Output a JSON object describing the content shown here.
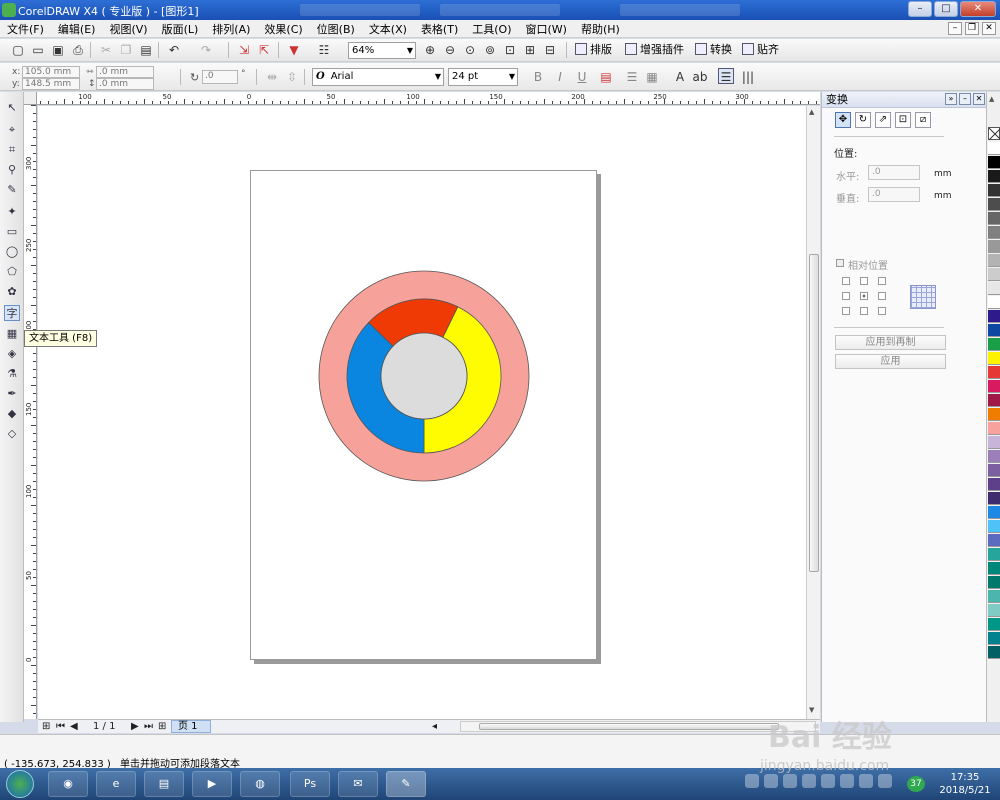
{
  "window": {
    "title": "CorelDRAW X4 ( 专业版 ) - [图形1]",
    "controls": [
      "–",
      "□",
      "✕"
    ]
  },
  "menu": [
    "文件(F)",
    "编辑(E)",
    "视图(V)",
    "版面(L)",
    "排列(A)",
    "效果(C)",
    "位图(B)",
    "文本(X)",
    "表格(T)",
    "工具(O)",
    "窗口(W)",
    "帮助(H)"
  ],
  "toolbar": {
    "zoom": "64%",
    "buttons": [
      "排版",
      "增强插件",
      "转换",
      "贴齐"
    ]
  },
  "property_bar": {
    "x_label": "x:",
    "x_value": "105.0 mm",
    "y_label": "y:",
    "y_value": "148.5 mm",
    "width_value": ".0 mm",
    "height_value": ".0 mm",
    "angle_value": ".0",
    "angle_unit": "°",
    "font_glyph": "O",
    "font_name": "Arial",
    "font_size": "24 pt"
  },
  "tooltip": "文本工具 (F8)",
  "rulers": {
    "horizontal": [
      "100",
      "50",
      "0",
      "50",
      "100",
      "150",
      "200",
      "250",
      "300"
    ],
    "vertical": [
      "300",
      "250",
      "200",
      "150",
      "100",
      "50",
      "0"
    ]
  },
  "page_nav": {
    "counter": "1 / 1",
    "tab": "页 1"
  },
  "docker": {
    "title": "变换",
    "section": "位置:",
    "h_label": "水平:",
    "h_value": ".0",
    "v_label": "垂直:",
    "v_value": ".0",
    "unit": "mm",
    "relative": "相对位置",
    "apply_duplicate": "应用到再制",
    "apply": "应用"
  },
  "donut": {
    "outer_ring_color": "#f6a19a",
    "segments": [
      {
        "color": "#fffb00",
        "start_deg": -64,
        "end_deg": 90
      },
      {
        "color": "#0a86e0",
        "start_deg": 90,
        "end_deg": 224
      },
      {
        "color": "#ef3a05",
        "start_deg": 224,
        "end_deg": 296
      }
    ],
    "hole_color": "#dcdcdc"
  },
  "palette": [
    "#ffffff",
    "#000000",
    "#1a1a1a",
    "#333333",
    "#4d4d4d",
    "#666666",
    "#808080",
    "#999999",
    "#b3b3b3",
    "#cccccc",
    "#e6e6e6",
    "#ffffff",
    "#2e1a8a",
    "#0d47a1",
    "#1b9e48",
    "#fff200",
    "#e53935",
    "#d81b60",
    "#a01848",
    "#ef7d00",
    "#f7a29c",
    "#c8b4d8",
    "#9c7fb8",
    "#7b5fa0",
    "#5e3f8a",
    "#3d2b6e",
    "#1e88e5",
    "#4fc3f7",
    "#5c6bc0",
    "#26a69a",
    "#00897b",
    "#00796b",
    "#4db6ac",
    "#80cbc4",
    "#009688",
    "#00838f",
    "#006064"
  ],
  "status": {
    "coords": "( -135.673, 254.833 )",
    "hint": "单击并拖动可添加段落文本"
  },
  "taskbar": {
    "apps": [
      "Ps"
    ],
    "badge": "37",
    "time": "17:35",
    "date": "2018/5/21"
  },
  "watermark": {
    "main": "Bai 经验",
    "sub": "jingyan.baidu.com"
  }
}
